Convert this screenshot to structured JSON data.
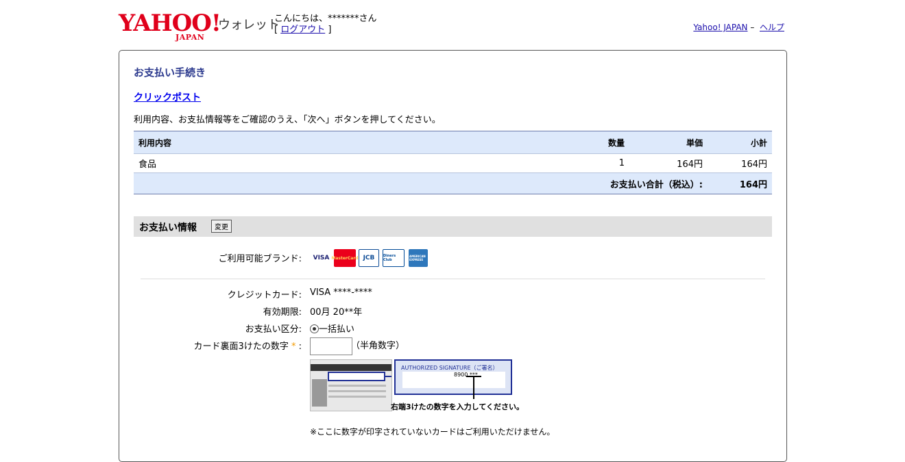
{
  "header": {
    "logo_text": "YAHOO!",
    "logo_sub": "JAPAN",
    "service_name": "ウォレット",
    "greeting": "こんにちは、*******さん",
    "logout_label": "ログアウト",
    "link_yahoo": "Yahoo! JAPAN",
    "link_sep": "–",
    "link_help": "ヘルプ"
  },
  "page": {
    "title": "お支払い手続き",
    "service_link": "クリックポスト",
    "instruction": "利用内容、お支払情報等をご確認のうえ、「次へ」ボタンを押してください。"
  },
  "order_table": {
    "headers": [
      "利用内容",
      "数量",
      "単価",
      "小計"
    ],
    "rows": [
      {
        "item": "食品",
        "qty": "1",
        "unit_price": "164円",
        "subtotal": "164円"
      }
    ],
    "total_label": "お支払い合計（税込）:",
    "total_value": "164円"
  },
  "payment": {
    "section_title": "お支払い情報",
    "change_button": "変更",
    "brands_label": "ご利用可能ブランド:",
    "brands": [
      "VISA",
      "MasterCard",
      "JCB",
      "Diners Club",
      "AMERICAN EXPRESS"
    ],
    "card_label": "クレジットカード:",
    "card_value": "VISA ****-****",
    "expiry_label": "有効期限:",
    "expiry_value": "00月 20**年",
    "method_label": "お支払い区分:",
    "method_value": "一括払い",
    "cvc_label": "カード裏面3けたの数字",
    "cvc_required": "*",
    "cvc_colon": ":",
    "cvc_value": "",
    "cvc_hint": "（半角数字）",
    "sig_caption": "AUTHORIZED SIGNATURE（ご署名）",
    "sig_number": "8900 ***",
    "cvc_caption": "右端3けたの数字を入力してください。",
    "footnote": "※ここに数字が印字されていないカードはご利用いただけません。"
  },
  "colors": {
    "yahoo_red": "#e0001b",
    "title_blue": "#2c3a8e",
    "table_header_bg": "#dde9fb",
    "section_bg": "#e0e0e0"
  }
}
